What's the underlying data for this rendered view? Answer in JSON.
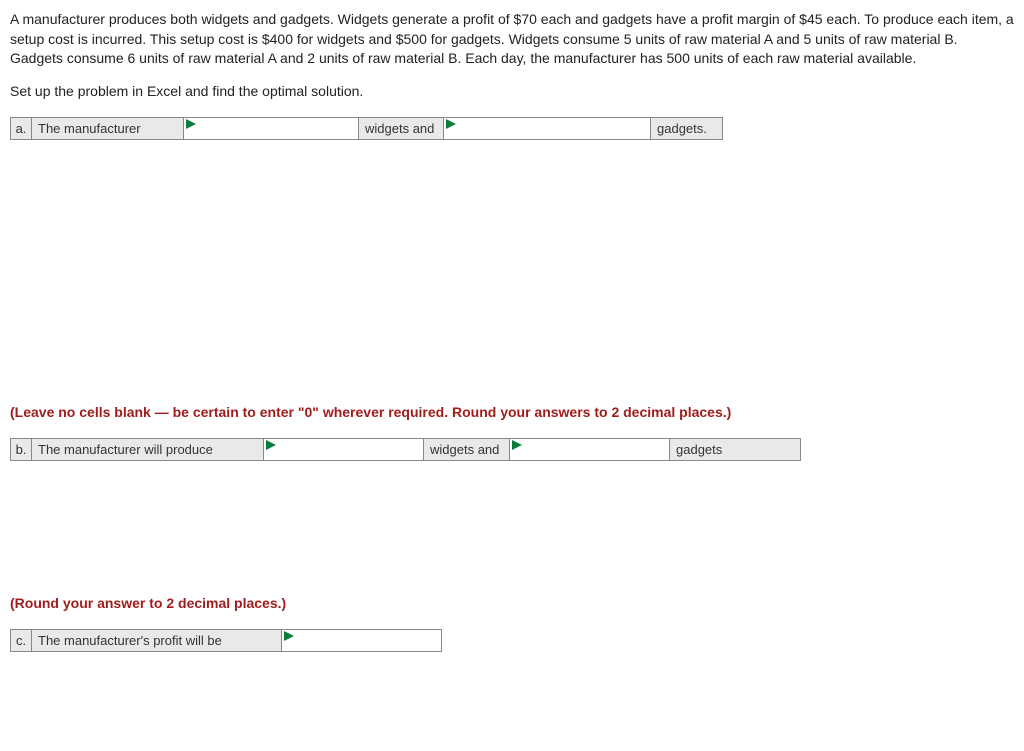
{
  "problem": {
    "paragraph": "A manufacturer produces both widgets and gadgets. Widgets generate a profit of $70 each and gadgets have a profit margin of $45 each. To produce each item, a setup cost is incurred. This setup cost is $400 for widgets and $500 for gadgets. Widgets consume 5 units of raw material A and 5 units of raw material B. Gadgets consume 6 units of raw material A and 2 units of raw material B. Each day, the manufacturer has 500 units of each raw material available.",
    "instruction": "Set up the problem in Excel and find the optimal solution."
  },
  "rowA": {
    "letter": "a.",
    "label": "The manufacturer",
    "mid": "widgets and",
    "end": "gadgets."
  },
  "hint1": "(Leave no cells blank — be certain to enter \"0\" wherever required. Round your answers to 2 decimal places.)",
  "rowB": {
    "letter": "b.",
    "label": "The manufacturer will produce",
    "mid": "widgets and",
    "end": "gadgets"
  },
  "hint2": "(Round your answer to 2 decimal places.)",
  "rowC": {
    "letter": "c.",
    "label": "The manufacturer's profit will be"
  }
}
